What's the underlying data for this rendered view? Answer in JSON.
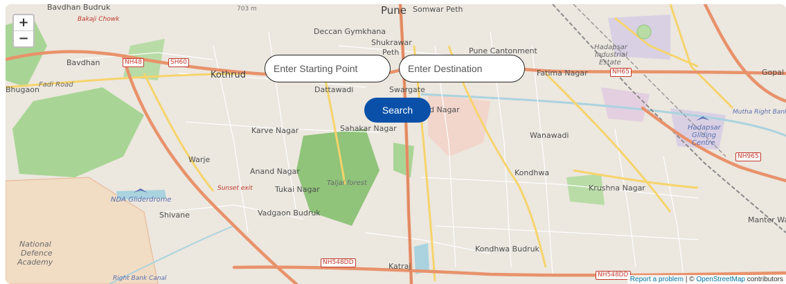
{
  "map": {
    "zoom_in_label": "+",
    "zoom_out_label": "−",
    "places": {
      "bavdhan_budruk": "Bavdhan Budruk",
      "bakaji_chowk": "Bakaji Chowk",
      "bavdhan": "Bavdhan",
      "bhugaon": "Bhugaon",
      "bhugaon_road": "Fadi Road",
      "kothrud": "Kothrud",
      "deccan": "Deccan Gymkhana",
      "pune": "Pune",
      "somwar_peth": "Somwar Peth",
      "shukrawar": "Shukrawar",
      "peth": "Peth",
      "pune_cantonment": "Pune Cantonment",
      "dattawadi": "Dattawadi",
      "swargate": "Swargate",
      "nd_nagar": "d Nagar",
      "sahakar_nagar": "Sahakar Nagar",
      "karve_nagar": "Karve Nagar",
      "warje": "Warje",
      "anand_nagar": "Anand Nagar",
      "tukai_nagar": "Tukai Nagar",
      "taljai_forest": "Taljai forest",
      "sunset_exit": "Sunset exit",
      "nda_gliderdrome": "NDA Gliderdrome",
      "shivane": "Shivane",
      "vadgaon_budruk": "Vadgaon Budruk",
      "national_defence": "National",
      "national_defence_2": "Defence",
      "national_defence_3": "Academy",
      "fatima_nagar": "Fatima Nagar",
      "hadapsar_industrial": "Hadapsar",
      "hadapsar_industrial_2": "Industrial",
      "hadapsar_industrial_3": "Estate",
      "wanawadi": "Wanawadi",
      "kondhwa": "Kondhwa",
      "krushna_nagar": "Krushna Nagar",
      "hadapsar_gliding": "Hadapsar",
      "hadapsar_gliding_2": "Gliding",
      "hadapsar_gliding_3": "Centre",
      "gopal": "Gopal",
      "manter_wa": "Manter Wa",
      "kondhwa_budruk": "Kondhwa Budruk",
      "katraj": "Katraj",
      "mutha_canal": "Mutha Right Bank Canal",
      "right_bank_canal": "Right Bank Canal",
      "scale_hint": "703 m"
    },
    "shields": {
      "nh48": "NH48",
      "sh60": "SH60",
      "nh65": "NH65",
      "nh965": "NH965",
      "nh548dd_a": "NH548DD",
      "nh548dd_b": "NH548DD"
    },
    "colors": {
      "land": "#ece7df",
      "park": "#a8d595",
      "forest": "#8fc47a",
      "major_road": "#e8926b",
      "secondary_road": "#f6d46b",
      "minor_road": "#ffffff",
      "water": "#aad3df",
      "rail": "#8a8a8a"
    }
  },
  "search": {
    "start_placeholder": "Enter Starting Point",
    "destination_placeholder": "Enter Destination",
    "start_value": "",
    "destination_value": "",
    "button_label": "Search"
  },
  "attribution": {
    "report": "Report a problem",
    "separator": " | © ",
    "osm": "OpenStreetMap",
    "suffix": " contributors"
  }
}
